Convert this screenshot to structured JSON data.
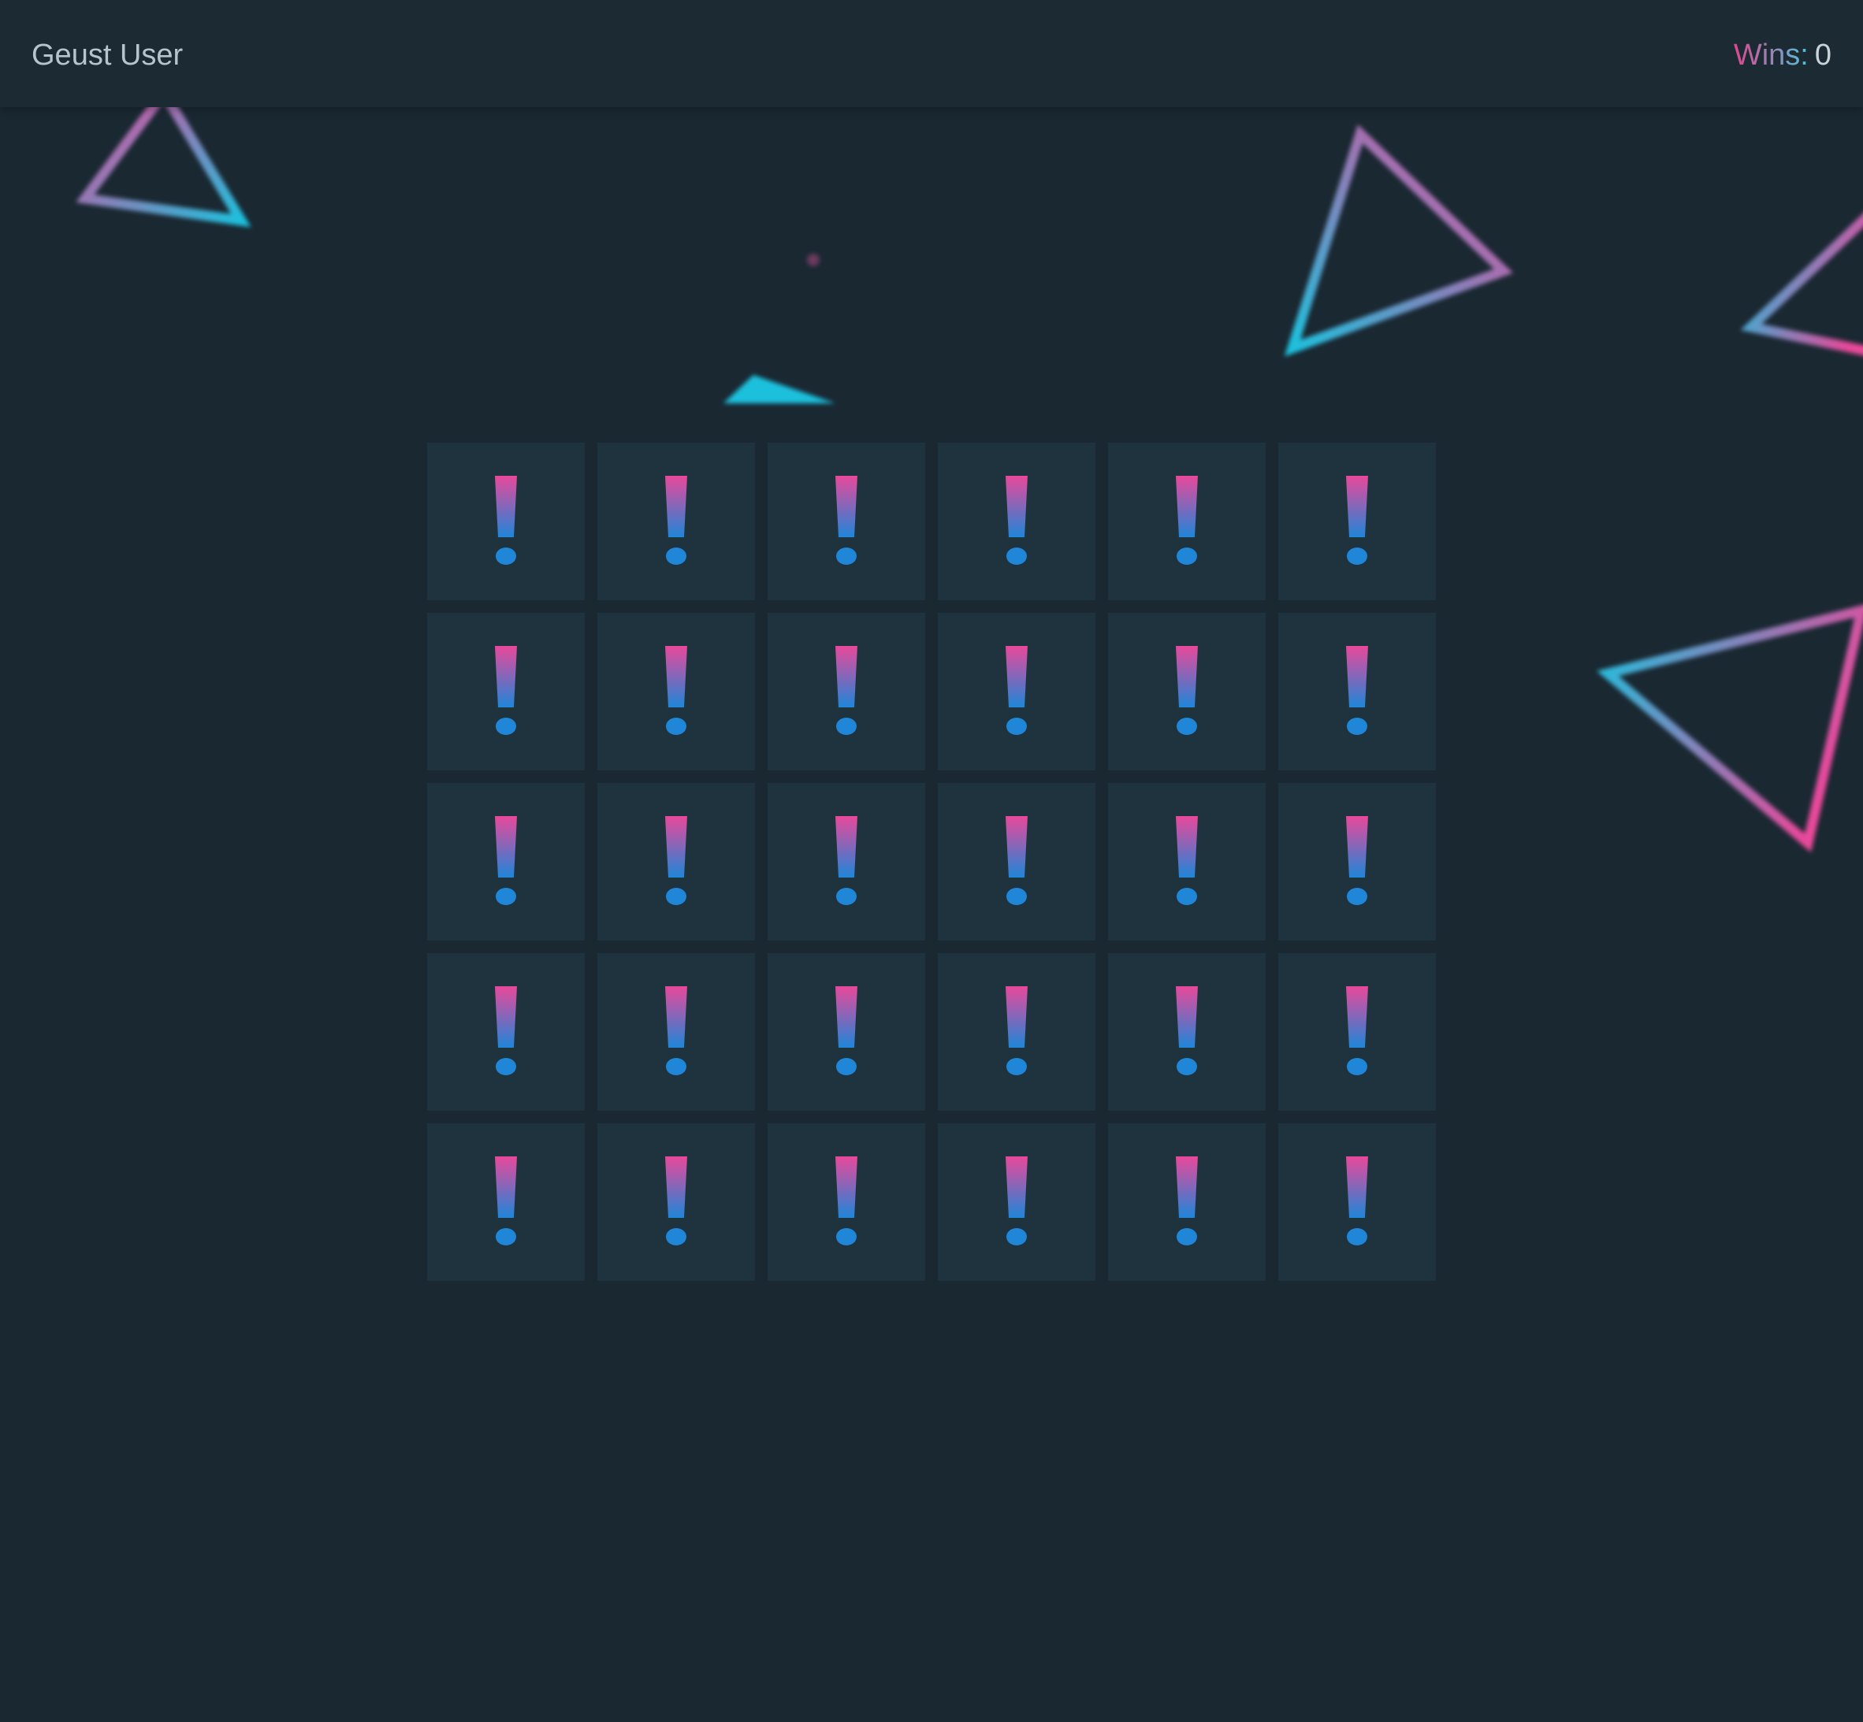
{
  "header": {
    "username": "Geust User",
    "wins_label": "Wins:",
    "wins_value": "0"
  },
  "board": {
    "rows": 5,
    "columns": 6,
    "tile_icon": "exclamation-icon",
    "tile_state": "hidden"
  },
  "colors": {
    "background": "#1a2832",
    "header": "#1b2a33",
    "tile": "#1f333e",
    "accent_pink": "#e8489a",
    "accent_cyan": "#1ec0dd",
    "accent_blue": "#1f86d8"
  },
  "decorations": {
    "shape": "neon-triangle",
    "count": 6
  }
}
